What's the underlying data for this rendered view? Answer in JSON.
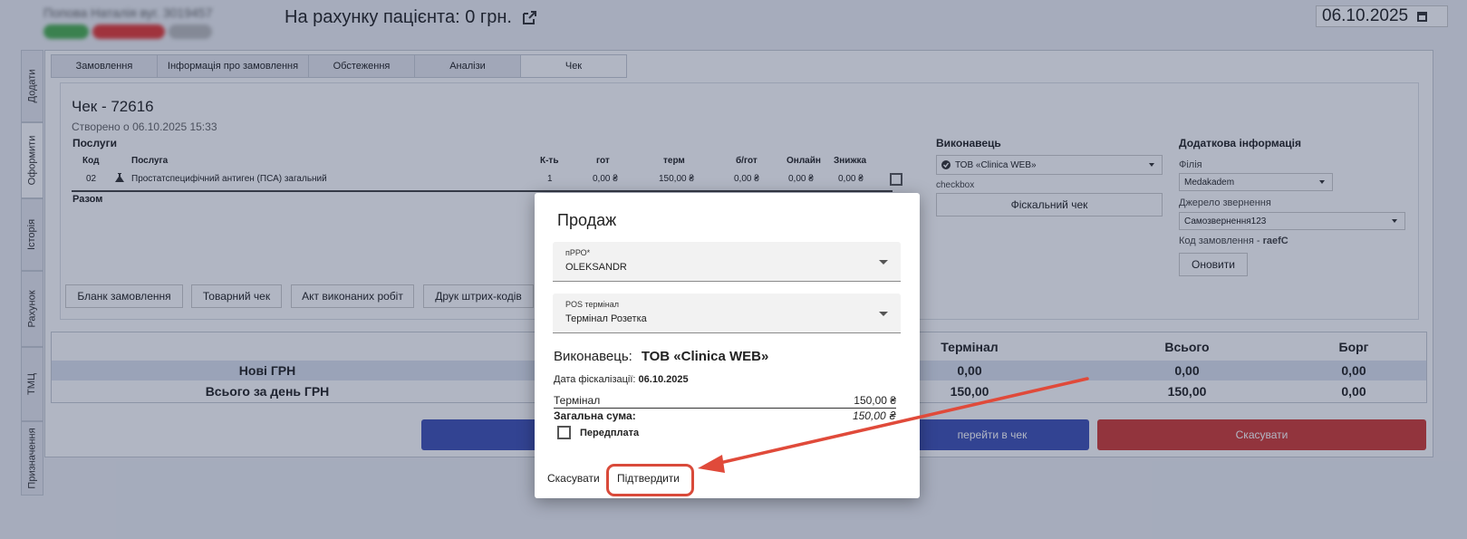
{
  "header": {
    "patient_name": "Попова Наталія вуг. 3019457",
    "balance_text": "На рахунку пацієнта: 0 грн.",
    "date": "06.10.2025"
  },
  "side_tabs": [
    "Додати",
    "Оформити",
    "Історія",
    "Рахунок",
    "ТМЦ",
    "Призначення"
  ],
  "top_tabs": [
    "Замовлення",
    "Інформація про замовлення",
    "Обстеження",
    "Аналізи",
    "Чек"
  ],
  "check": {
    "title": "Чек - 72616",
    "created": "Створено о 06.10.2025 15:33",
    "services_label": "Послуги",
    "columns": [
      "Код",
      "Послуга",
      "К-ть",
      "гот",
      "терм",
      "б/гот",
      "Онлайн",
      "Знижка"
    ],
    "row": {
      "code": "02",
      "service": "Простатспецифічний антиген (ПСА) загальний",
      "qty": "1",
      "cash": "0,00 ₴",
      "term": "150,00 ₴",
      "noncash": "0,00 ₴",
      "online": "0,00 ₴",
      "discount": "0,00 ₴"
    },
    "total_label": "Разом",
    "buttons": [
      "Бланк замовлення",
      "Товарний чек",
      "Акт виконаних робіт",
      "Друк штрих-кодів"
    ]
  },
  "executor_panel": {
    "title": "Виконавець",
    "selected": "ТОВ «Clinica WEB»",
    "checkbox_label": "checkbox",
    "fiscal_button": "Фіскальний чек"
  },
  "extra_panel": {
    "title": "Додаткова інформація",
    "branch_label": "Філія",
    "branch_value": "Medakadem",
    "source_label": "Джерело звернення",
    "source_value": "Самозвернення123",
    "order_code_label": "Код замовлення -",
    "order_code_value": "raefC",
    "update_button": "Оновити"
  },
  "totals": {
    "columns": [
      "Термінал",
      "Всього",
      "Борг"
    ],
    "rows": [
      {
        "label": "Нові ГРН",
        "terminal": "0,00",
        "total": "0,00",
        "debt": "0,00"
      },
      {
        "label": "Всього за день ГРН",
        "terminal": "150,00",
        "total": "150,00",
        "debt": "0,00"
      }
    ]
  },
  "actions": {
    "go_to_check": "перейти в чек",
    "cancel": "Скасувати"
  },
  "modal": {
    "title": "Продаж",
    "prro_label": "пРРО*",
    "prro_value": "OLEKSANDR",
    "pos_label": "POS термінал",
    "pos_value": "Термінал Розетка",
    "executor_label": "Виконавець:",
    "executor_value": "ТОВ «Clinica WEB»",
    "fiscal_date_label": "Дата фіскалізації:",
    "fiscal_date_value": "06.10.2025",
    "terminal_label": "Термінал",
    "terminal_value": "150,00 ₴",
    "sum_label": "Загальна сума:",
    "sum_value": "150,00 ₴",
    "prepay_label": "Передплата",
    "cancel_button": "Скасувати",
    "confirm_button": "Підтвердити"
  },
  "colors": {
    "primary_blue": "#3f51b5",
    "danger_red": "#d03a34",
    "highlight_red": "#d94a3a"
  }
}
